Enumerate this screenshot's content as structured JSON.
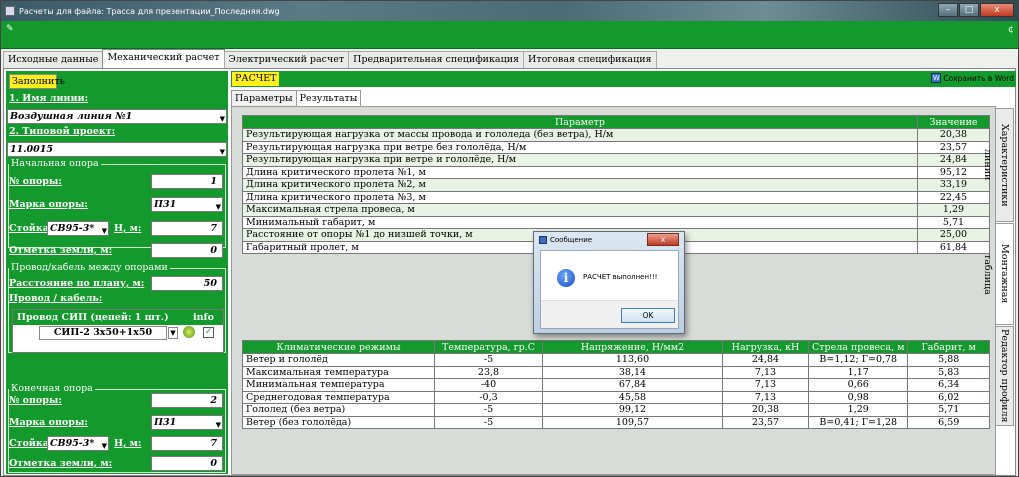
{
  "window": {
    "title": "Расчеты для файла: Трасса для презентации_Последняя.dwg",
    "btn_min": "–",
    "btn_max": "□",
    "btn_close": "x"
  },
  "toolbar": {
    "icon": "✎",
    "right_glyph": "¢"
  },
  "tabs": [
    "Исходные данные",
    "Механический расчет",
    "Электрический расчет",
    "Предварительная спецификация",
    "Итоговая спецификация"
  ],
  "left": {
    "fill_button": "Заполнить",
    "line_name_label": "1. Имя линии:",
    "line_name_value": "Воздушная линия №1",
    "project_label": "2. Типовой проект:",
    "project_value": "11.0015",
    "start_group": "Начальная опора",
    "start_num_label": "№ опоры:",
    "start_num_value": "1",
    "start_mark_label": "Марка опоры:",
    "start_mark_value": "П31",
    "start_rack_label": "Стойка:",
    "start_rack_value": "СВ95-3*",
    "start_h_label": "Н, м:",
    "start_h_value": "7",
    "start_ground_label": "Отметка земли, м:",
    "start_ground_value": "0",
    "wire_group": "Провод/кабель между опорами",
    "wire_distance_label": "Расстояние по плану, м:",
    "wire_distance_value": "50",
    "wire_cable_label": "Провод / кабель:",
    "sip_header": "Провод СИП (цепей: 1 шт.)",
    "sip_info": "info",
    "sip_value": "СИП-2 3х50+1х50",
    "end_group": "Конечная опора",
    "end_num_label": "№ опоры:",
    "end_num_value": "2",
    "end_mark_label": "Марка опоры:",
    "end_mark_value": "П31",
    "end_rack_label": "Стойка:",
    "end_rack_value": "СВ95-3*",
    "end_h_label": "Н, м:",
    "end_h_value": "7",
    "end_ground_label": "Отметка земли, м:",
    "end_ground_value": "0"
  },
  "right": {
    "calc_label": "РАСЧЕТ",
    "save_word": "Сохранить в Word",
    "subtabs": [
      "Параметры",
      "Результаты"
    ],
    "side_tabs": [
      "Характеристики линии",
      "Монтажная таблица",
      "Редактор профиля"
    ],
    "table1_headers": [
      "Параметр",
      "Значение"
    ],
    "table1_rows": [
      [
        "Результирующая нагрузка от массы провода и гололеда (без ветра), Н/м",
        "20,38"
      ],
      [
        "Результирующая нагрузка при ветре без гололёда, Н/м",
        "23,57"
      ],
      [
        "Результирующая нагрузка при ветре и гололёде, Н/м",
        "24,84"
      ],
      [
        "Длина критического пролета №1, м",
        "95,12"
      ],
      [
        "Длина критического пролета №2, м",
        "33,19"
      ],
      [
        "Длина критического пролета №3, м",
        "22,45"
      ],
      [
        "Максимальная стрела провеса, м",
        "1,29"
      ],
      [
        "Минимальный габарит, м",
        "5,71"
      ],
      [
        "Расстояние от опоры №1 до низшей точки, м",
        "25,00"
      ],
      [
        "Габаритный пролет, м",
        "61,84"
      ]
    ],
    "table2_headers": [
      "Климатические режимы",
      "Температура, гр.С",
      "Напряжение, Н/мм2",
      "Нагрузка, кН",
      "Стрела провеса, м",
      "Габарит, м"
    ],
    "table2_rows": [
      [
        "Ветер и гололёд",
        "-5",
        "113,60",
        "24,84",
        "В=1,12; Г=0,78",
        "5,88"
      ],
      [
        "Максимальная температура",
        "23,8",
        "38,14",
        "7,13",
        "1,17",
        "5,83"
      ],
      [
        "Минимальная температура",
        "-40",
        "67,84",
        "7,13",
        "0,66",
        "6,34"
      ],
      [
        "Среднегодовая температура",
        "-0,3",
        "45,58",
        "7,13",
        "0,98",
        "6,02"
      ],
      [
        "Гололед (без ветра)",
        "-5",
        "99,12",
        "20,38",
        "1,29",
        "5,71"
      ],
      [
        "Ветер (без гололёда)",
        "-5",
        "109,57",
        "23,57",
        "В=0,41; Г=1,28",
        "6,59"
      ]
    ]
  },
  "dialog": {
    "title": "Сообщение",
    "close": "x",
    "message": "РАСЧЕТ выполнен!!!",
    "ok": "OK"
  },
  "colors": {
    "accent_green": "#149a2c",
    "highlight_yellow": "#ffef1a"
  }
}
